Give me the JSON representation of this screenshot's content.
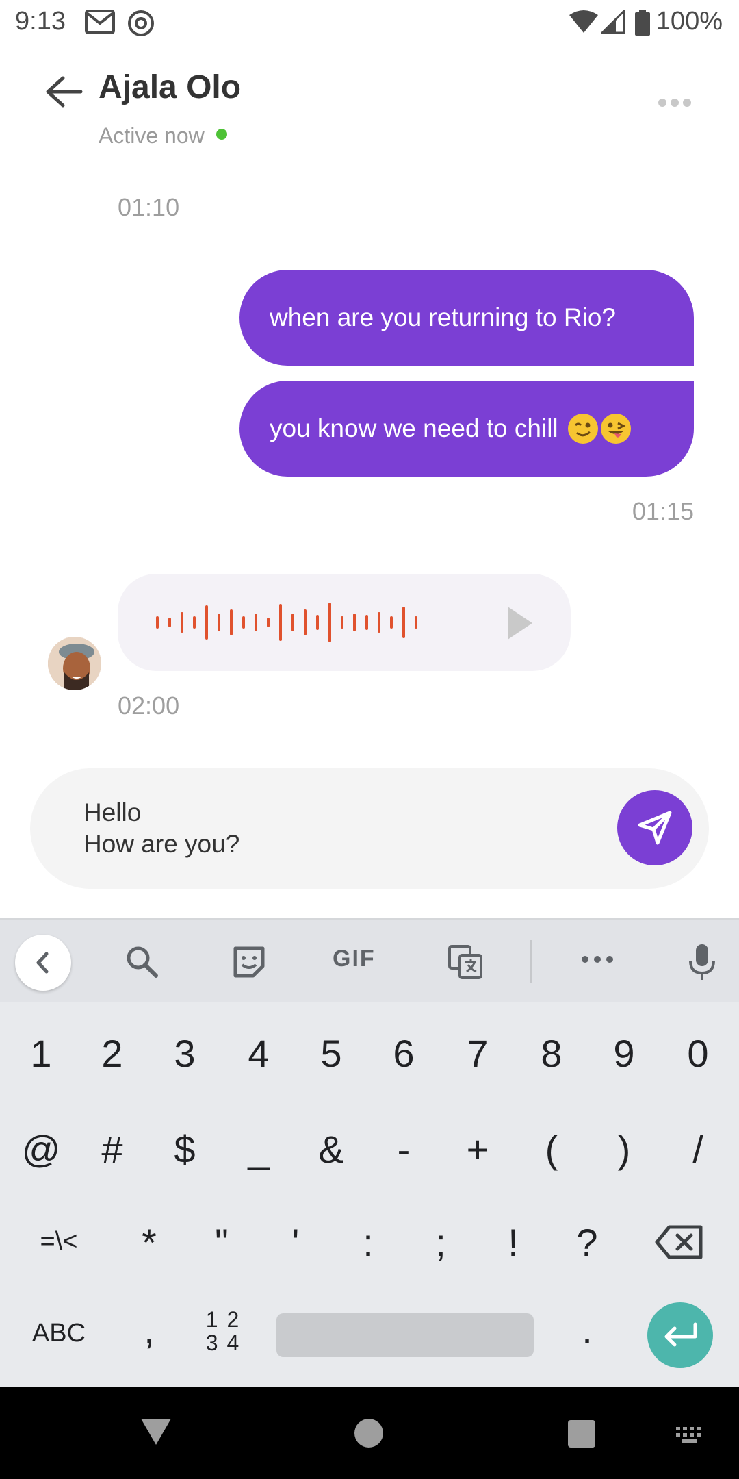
{
  "status_bar": {
    "time": "9:13",
    "battery": "100%",
    "icons": [
      "gmail-icon",
      "at-sign-icon",
      "wifi-icon",
      "signal-icon",
      "battery-icon"
    ]
  },
  "header": {
    "contact_name": "Ajala Olo",
    "status": "Active now",
    "status_color": "#4ec236",
    "back_icon": "arrow-left-icon",
    "more_icon": "more-horizontal-icon"
  },
  "chat": {
    "timestamp_1": "01:10",
    "messages_out": [
      {
        "text": "when are you returning to Rio?"
      },
      {
        "text": "you know we need to chill",
        "emojis": [
          "winking-face",
          "tongue-wink-face"
        ]
      }
    ],
    "timestamp_2": "01:15",
    "voice_message": {
      "play_icon": "play-icon"
    },
    "timestamp_3": "02:00",
    "accent_color": "#7b3fd4"
  },
  "composer": {
    "value": "Hello\nHow are you?",
    "send_icon": "send-icon"
  },
  "keyboard": {
    "toolbar": {
      "gif_label": "GIF"
    },
    "row1": [
      "1",
      "2",
      "3",
      "4",
      "5",
      "6",
      "7",
      "8",
      "9",
      "0"
    ],
    "row2": [
      "@",
      "#",
      "$",
      "_",
      "&",
      "-",
      "+",
      "(",
      ")",
      "/"
    ],
    "row3": [
      "=\\<",
      "*",
      "\"",
      "'",
      ":",
      ";",
      "!",
      "?"
    ],
    "row4": {
      "abc": "ABC",
      "comma": ",",
      "numpad": "1 2\n3 4",
      "period": "."
    }
  }
}
